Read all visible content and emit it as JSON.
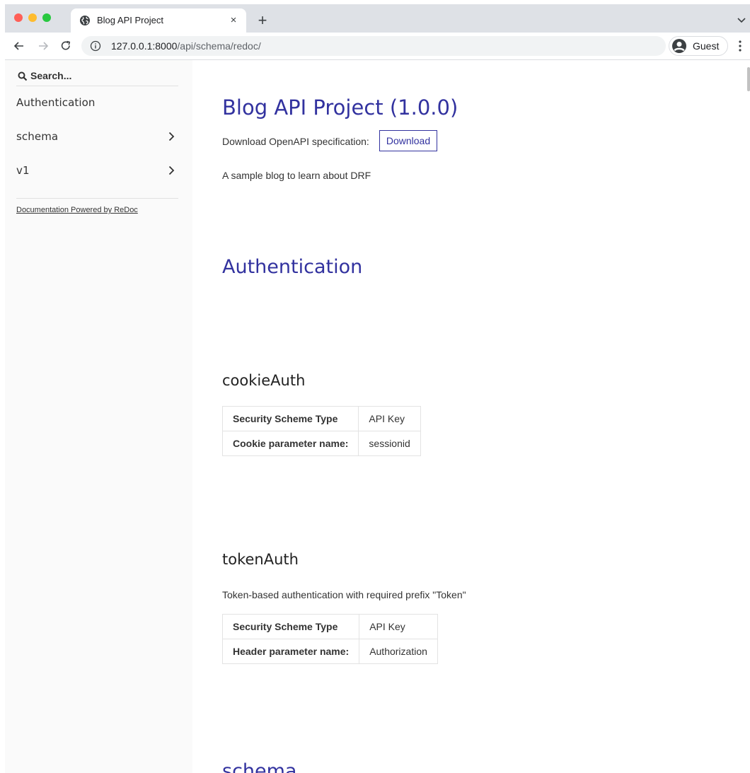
{
  "browser": {
    "tab_title": "Blog API Project",
    "tab_close": "×",
    "new_tab": "+",
    "url_host": "127.0.0.1:8000",
    "url_path": "/api/schema/redoc/",
    "profile_label": "Guest"
  },
  "sidebar": {
    "search_placeholder": "Search...",
    "items": [
      {
        "label": "Authentication",
        "has_children": false
      },
      {
        "label": "schema",
        "has_children": true
      },
      {
        "label": "v1",
        "has_children": true
      }
    ],
    "powered_by": "Documentation Powered by ReDoc"
  },
  "content": {
    "title": "Blog API Project (1.0.0)",
    "download_label": "Download OpenAPI specification:",
    "download_button": "Download",
    "description": "A sample blog to learn about DRF",
    "auth_heading": "Authentication",
    "schemes": [
      {
        "name": "cookieAuth",
        "description": "",
        "rows": [
          {
            "key": "Security Scheme Type",
            "value": "API Key"
          },
          {
            "key": "Cookie parameter name:",
            "value": "sessionid"
          }
        ]
      },
      {
        "name": "tokenAuth",
        "description": "Token-based authentication with required prefix \"Token\"",
        "rows": [
          {
            "key": "Security Scheme Type",
            "value": "API Key"
          },
          {
            "key": "Header parameter name:",
            "value": "Authorization"
          }
        ]
      }
    ],
    "next_heading": "schema"
  },
  "colors": {
    "accent": "#32329f",
    "sidebar_bg": "#fafafa",
    "tabstrip_bg": "#dee1e6"
  }
}
